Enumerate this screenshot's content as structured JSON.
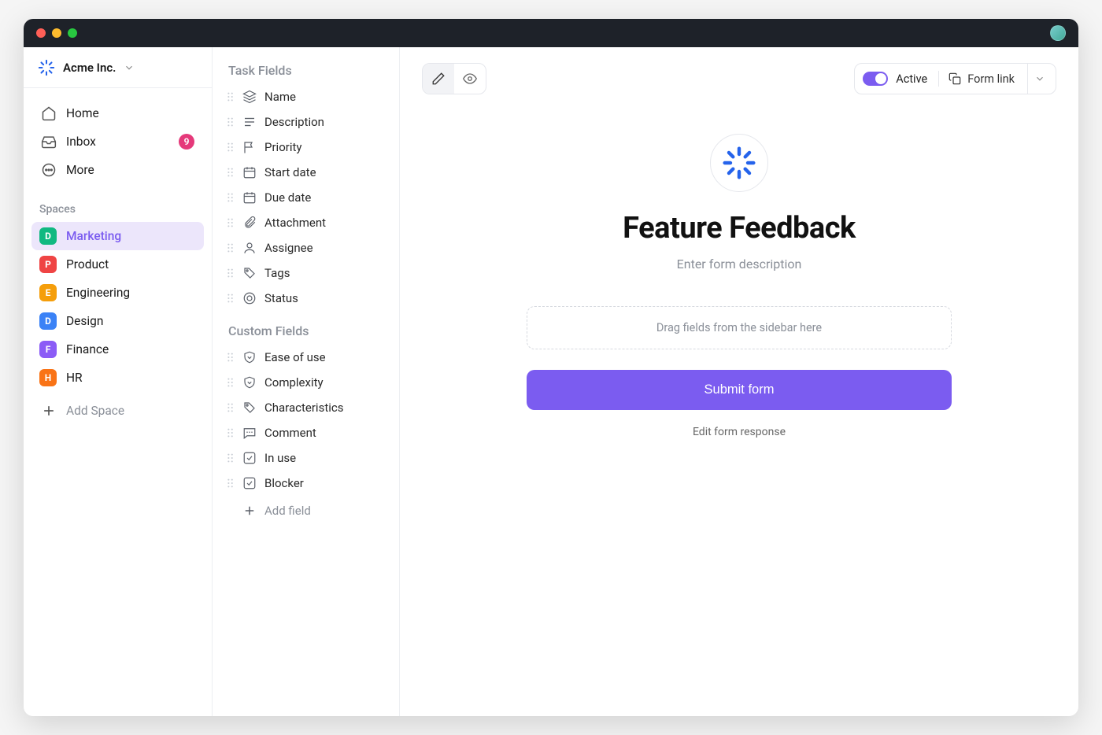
{
  "workspace": {
    "name": "Acme Inc."
  },
  "nav": {
    "home": "Home",
    "inbox": "Inbox",
    "inbox_badge": "9",
    "more": "More"
  },
  "spaces_label": "Spaces",
  "spaces": [
    {
      "letter": "D",
      "color": "#10b981",
      "label": "Marketing",
      "active": true
    },
    {
      "letter": "P",
      "color": "#ef4444",
      "label": "Product"
    },
    {
      "letter": "E",
      "color": "#f59e0b",
      "label": "Engineering"
    },
    {
      "letter": "D",
      "color": "#3b82f6",
      "label": "Design"
    },
    {
      "letter": "F",
      "color": "#8b5cf6",
      "label": "Finance"
    },
    {
      "letter": "H",
      "color": "#f97316",
      "label": "HR"
    }
  ],
  "add_space": "Add Space",
  "task_fields_heading": "Task Fields",
  "task_fields": [
    {
      "icon": "layers",
      "label": "Name"
    },
    {
      "icon": "text",
      "label": "Description"
    },
    {
      "icon": "flag",
      "label": "Priority"
    },
    {
      "icon": "calendar",
      "label": "Start date"
    },
    {
      "icon": "calendar",
      "label": "Due date"
    },
    {
      "icon": "paperclip",
      "label": "Attachment"
    },
    {
      "icon": "user",
      "label": "Assignee"
    },
    {
      "icon": "tag",
      "label": "Tags"
    },
    {
      "icon": "target",
      "label": "Status"
    }
  ],
  "custom_fields_heading": "Custom Fields",
  "custom_fields": [
    {
      "icon": "shield-down",
      "label": "Ease of use"
    },
    {
      "icon": "shield-down",
      "label": "Complexity"
    },
    {
      "icon": "tag",
      "label": "Characteristics"
    },
    {
      "icon": "comment",
      "label": "Comment"
    },
    {
      "icon": "check-square",
      "label": "In use"
    },
    {
      "icon": "check-square",
      "label": "Blocker"
    }
  ],
  "add_field": "Add field",
  "toolbar": {
    "active_label": "Active",
    "form_link": "Form link"
  },
  "form": {
    "title": "Feature Feedback",
    "description_placeholder": "Enter form description",
    "drop_hint": "Drag fields from the sidebar here",
    "submit": "Submit form",
    "edit_response": "Edit form response"
  }
}
